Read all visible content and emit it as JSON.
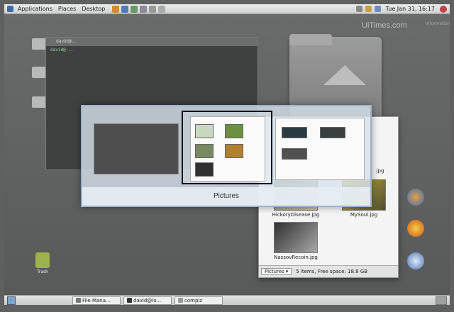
{
  "top_panel": {
    "menus": [
      "Applications",
      "Places",
      "Desktop"
    ],
    "clock": "Tue Jan 31, 16:17"
  },
  "watermark": {
    "text": "UiTimes.com",
    "sub": "information"
  },
  "terminal": {
    "title": "david@...",
    "line": "david@..."
  },
  "file_window": {
    "files": [
      "HickoryDisease.jpg",
      "MySoul.jpg",
      "NassovRecoin.jpg"
    ],
    "location_select": "Pictures",
    "status": "5 items, Free space: 18.8 GB",
    "partial_label": "jpg"
  },
  "switcher": {
    "selected_title": "Pictures"
  },
  "desktop_icons": {
    "trash": "Trash"
  },
  "bottom_panel": {
    "tasks": [
      "File Mana...",
      "david@lo...",
      "compiz"
    ]
  }
}
